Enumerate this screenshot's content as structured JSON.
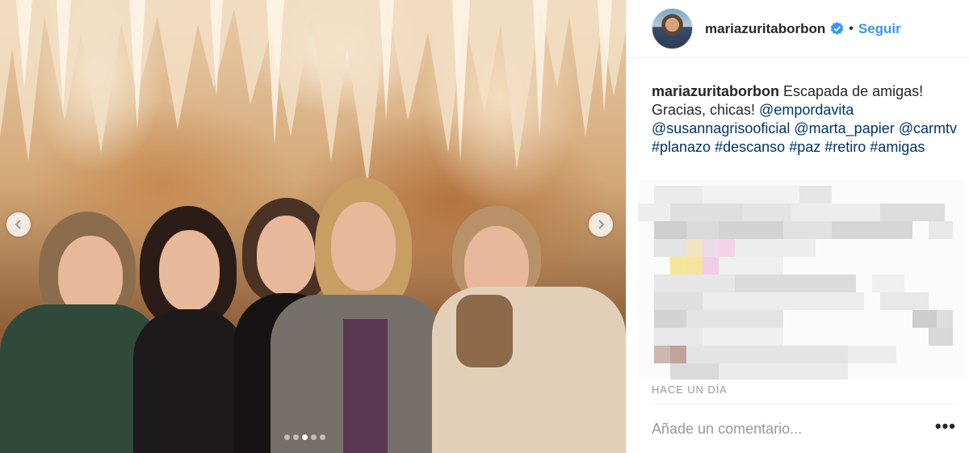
{
  "post": {
    "username": "mariazuritaborbon",
    "verified": true,
    "separator": "•",
    "follow_label": "Seguir",
    "caption": {
      "username": "mariazuritaborbon",
      "text_part1": " Escapada de amigas! Gracias, chicas! ",
      "mention_1": "@empordavita",
      "mention_2": "@susannagrisooficial",
      "mention_3": "@marta_papier",
      "mention_4": "@carmtv",
      "tag_1": "#planazo",
      "tag_2": "#descanso",
      "tag_3": "#paz",
      "tag_4": "#retiro",
      "tag_5": "#amigas"
    },
    "timestamp": "HACE UN DÍA",
    "comment_placeholder": "Añade un comentario...",
    "more_label": "•••",
    "carousel": {
      "total": 5,
      "active_index": 2
    }
  },
  "colors": {
    "link": "#003569",
    "follow": "#3897f0",
    "verified": "#3897f0",
    "muted": "#999999"
  },
  "icons": {
    "prev": "chevron-left-icon",
    "next": "chevron-right-icon",
    "verified": "verified-badge-icon",
    "more": "more-options-icon"
  }
}
